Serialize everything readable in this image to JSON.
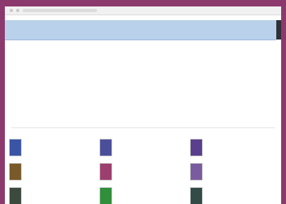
{
  "window": {
    "address": ""
  },
  "header": {
    "title": ""
  },
  "intro": {
    "lines": [
      "",
      "",
      "",
      "",
      ""
    ]
  },
  "link": {
    "label": ""
  },
  "grid": {
    "items": [
      {
        "name": "",
        "color": "#3b55a6"
      },
      {
        "name": "",
        "color": "#4b4f9a"
      },
      {
        "name": "",
        "color": "#5a3f8e"
      },
      {
        "name": "",
        "color": "#7a5a2a"
      },
      {
        "name": "",
        "color": "#9c3f6f"
      },
      {
        "name": "",
        "color": "#7b5b9f"
      },
      {
        "name": "",
        "color": "#3c4a3e"
      },
      {
        "name": "",
        "color": "#2f8f3a"
      },
      {
        "name": "",
        "color": "#324b46"
      }
    ]
  }
}
